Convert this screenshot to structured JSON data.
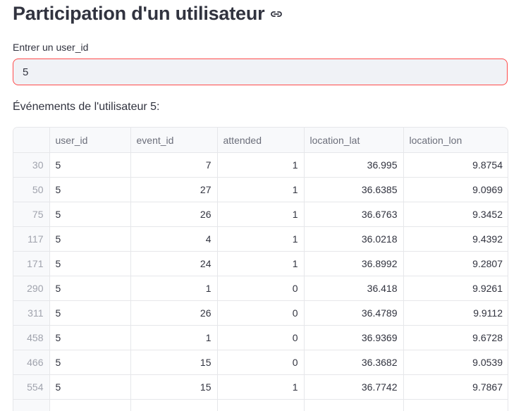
{
  "page": {
    "title": "Participation d'un utilisateur",
    "link_icon": "link-icon"
  },
  "input": {
    "label": "Entrer un user_id",
    "value": "5"
  },
  "subheading": "Événements de l'utilisateur 5:",
  "table": {
    "columns": [
      "",
      "user_id",
      "event_id",
      "attended",
      "location_lat",
      "location_lon"
    ],
    "rows": [
      {
        "index": "30",
        "user_id": "5",
        "event_id": "7",
        "attended": "1",
        "location_lat": "36.995",
        "location_lon": "9.8754"
      },
      {
        "index": "50",
        "user_id": "5",
        "event_id": "27",
        "attended": "1",
        "location_lat": "36.6385",
        "location_lon": "9.0969"
      },
      {
        "index": "75",
        "user_id": "5",
        "event_id": "26",
        "attended": "1",
        "location_lat": "36.6763",
        "location_lon": "9.3452"
      },
      {
        "index": "117",
        "user_id": "5",
        "event_id": "4",
        "attended": "1",
        "location_lat": "36.0218",
        "location_lon": "9.4392"
      },
      {
        "index": "171",
        "user_id": "5",
        "event_id": "24",
        "attended": "1",
        "location_lat": "36.8992",
        "location_lon": "9.2807"
      },
      {
        "index": "290",
        "user_id": "5",
        "event_id": "1",
        "attended": "0",
        "location_lat": "36.418",
        "location_lon": "9.9261"
      },
      {
        "index": "311",
        "user_id": "5",
        "event_id": "26",
        "attended": "0",
        "location_lat": "36.4789",
        "location_lon": "9.9112"
      },
      {
        "index": "458",
        "user_id": "5",
        "event_id": "1",
        "attended": "0",
        "location_lat": "36.9369",
        "location_lon": "9.6728"
      },
      {
        "index": "466",
        "user_id": "5",
        "event_id": "15",
        "attended": "0",
        "location_lat": "36.3682",
        "location_lon": "9.0539"
      },
      {
        "index": "554",
        "user_id": "5",
        "event_id": "15",
        "attended": "1",
        "location_lat": "36.7742",
        "location_lon": "9.7867"
      },
      {
        "index": "",
        "user_id": "",
        "event_id": "",
        "attended": "",
        "location_lat": "",
        "location_lon": ""
      }
    ]
  },
  "colors": {
    "focus_border": "#ff4b4b",
    "input_bg": "#f0f2f6",
    "text": "#31333f",
    "muted": "#a0a3ad",
    "grid": "#e6e7ea"
  }
}
